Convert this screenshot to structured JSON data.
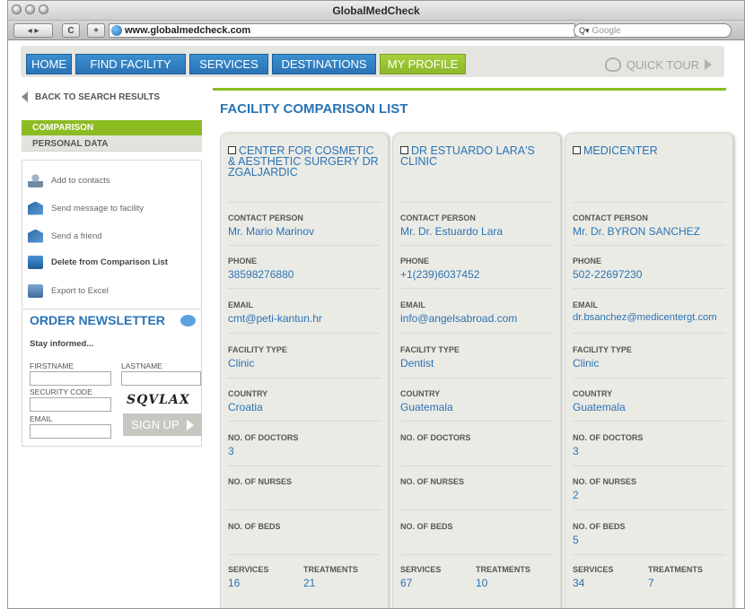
{
  "browser": {
    "window_title": "GlobalMedCheck",
    "back_forward": "◂ ▸",
    "reload": "C",
    "add": "+",
    "url": "www.globalmedcheck.com",
    "search_placeholder": "Google"
  },
  "nav": {
    "items": [
      "HOME",
      "FIND FACILITY",
      "SERVICES",
      "DESTINATIONS",
      "MY PROFILE"
    ],
    "quick_tour": "QUICK TOUR"
  },
  "sidebar": {
    "back": "BACK TO SEARCH RESULTS",
    "tab_comparison": "COMPARISON",
    "tab_personal": "PERSONAL DATA",
    "actions": [
      "Add to contacts",
      "Send message to facility",
      "Send a friend",
      "Delete from Comparison List",
      "Export to Excel"
    ]
  },
  "newsletter": {
    "title": "ORDER NEWSLETTER",
    "subtitle": "Stay informed...",
    "firstname": "FIRSTNAME",
    "lastname": "LASTNAME",
    "security_code": "SECURITY CODE",
    "captcha": "SQVLAX",
    "email": "EMAIL",
    "signup": "SIGN UP"
  },
  "main": {
    "title": "FACILITY COMPARISON LIST",
    "labels": {
      "contact": "CONTACT PERSON",
      "phone": "PHONE",
      "email": "EMAIL",
      "type": "FACILITY TYPE",
      "country": "COUNTRY",
      "doctors": "NO. OF DOCTORS",
      "nurses": "NO. OF NURSES",
      "beds": "NO. OF BEDS",
      "services": "SERVICES",
      "treatments": "TREATMENTS"
    },
    "facilities": [
      {
        "name": "CENTER FOR COSMETIC & AESTHETIC SURGERY DR ZGALJARDIC",
        "contact": "Mr. Mario Marinov",
        "phone": "38598276880",
        "email": "cmt@peti-kantun.hr",
        "type": "Clinic",
        "country": "Croatia",
        "doctors": "3",
        "nurses": "",
        "beds": "",
        "services": "16",
        "treatments": "21"
      },
      {
        "name": "DR ESTUARDO LARA'S CLINIC",
        "contact": "Mr. Dr. Estuardo Lara",
        "phone": "+1(239)6037452",
        "email": "info@angelsabroad.com",
        "type": "Dentist",
        "country": "Guatemala",
        "doctors": "",
        "nurses": "",
        "beds": "",
        "services": "67",
        "treatments": "10"
      },
      {
        "name": "MEDICENTER",
        "contact": "Mr. Dr. BYRON SANCHEZ",
        "phone": "502-22697230",
        "email": "dr.bsanchez@medicentergt.com",
        "type": "Clinic",
        "country": "Guatemala",
        "doctors": "3",
        "nurses": "2",
        "beds": "5",
        "services": "34",
        "treatments": "7"
      }
    ]
  }
}
